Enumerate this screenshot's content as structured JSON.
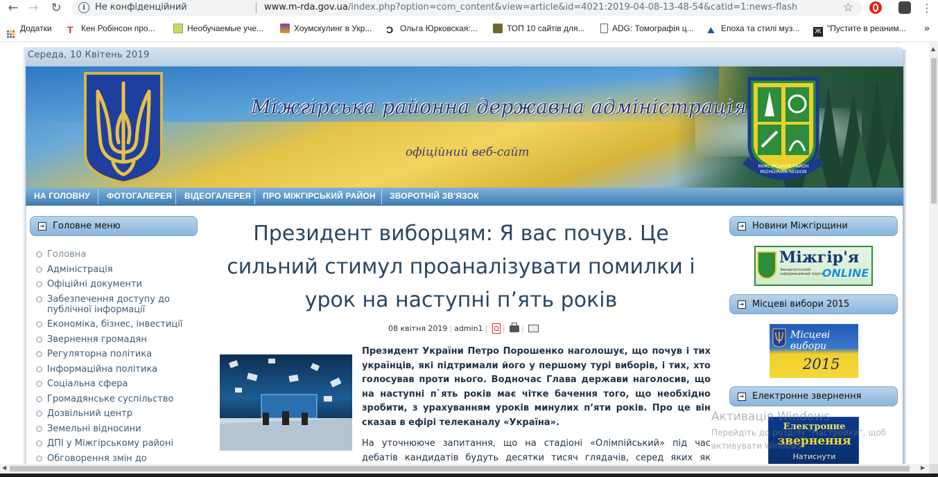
{
  "browser": {
    "security_label": "Не конфіденційний",
    "url_host": "www.m-rda.gov.ua",
    "url_path": "/index.php?option=com_content&view=article&id=4021:2019-04-08-13-48-54&catid=1:news-flash",
    "bookmarks": [
      {
        "label": "Додатки"
      },
      {
        "label": "Кен Робінсон про..."
      },
      {
        "label": "Необучаемые уче..."
      },
      {
        "label": "Хоумскулинг в Укр..."
      },
      {
        "label": "Ольга Юрковская:..."
      },
      {
        "label": "ТОП 10 сайтів для..."
      },
      {
        "label": "ADG: Томографія ц..."
      },
      {
        "label": "Епоха та стилі муз..."
      },
      {
        "label": "\"Пустите в реаним..."
      }
    ],
    "more_bookmarks": "»"
  },
  "site": {
    "date": "Середа, 10 Квітень 2019",
    "title": "Міжгірська районна державна адміністрація",
    "subtitle": "офіційний веб-сайт",
    "emblem_text": "МІЖГІРСЬКИЙ РАЙОН MIZHGIRIAN REGION"
  },
  "topnav": [
    "НА ГОЛОВНУ",
    "ФОТОГАЛЕРЕЯ",
    "ВІДЕОГАЛЕРЕЯ",
    "ПРО МІЖГІРСЬКИЙ РАЙОН",
    "ЗВОРОТНІЙ ЗВ'ЯЗОК"
  ],
  "left": {
    "heading": "Головне меню",
    "items": [
      "Головна",
      "Адміністрація",
      "Офіційні документи",
      "Забезпечення доступу до публічної інформації",
      "Економіка, бізнес, інвестиції",
      "Звернення громадян",
      "Регуляторна політика",
      "Інформаційна політика",
      "Соціальна сфера",
      "Громадянське суспільство",
      "Дозвільний центр",
      "Земельні відносини",
      "ДПІ у Міжгірському районі",
      "Обговорення змін до"
    ]
  },
  "article": {
    "title": "Президент виборцям: Я вас почув. Це сильний стимул проаналізувати помилки і урок на наступні п’ять років",
    "date": "08 квітня 2019",
    "author": "admin1",
    "lead": "Президент України Петро Порошенко наголошує, що почув і тих українців, які підтримали його у першому турі виборів, і тих, хто голосував проти нього. Водночас Глава держави наголосив, що на наступні п`ять років має чітке бачення того, що необхідно зробити, з урахуванням уроків минулих п’яти років. Про це він сказав в ефірі телеканалу «Україна».",
    "body": "На уточнююче запитання, що на стадіоні «Олімпійський» під час дебатів кандидатів будуть десятки тисяч глядачів, серед яких як прихильники Петра"
  },
  "right": {
    "news_heading": "Новини Міжгірщини",
    "news_banner_title": "Міжгір'я",
    "news_banner_sub": "Закарпатський інформаційний портал",
    "news_banner_online": "ONLINE",
    "elections_heading": "Місцеві вибори 2015",
    "elections_banner_title": "Місцеві вибори",
    "elections_banner_year": "2015",
    "appeal_heading": "Електронне звернення",
    "appeal_banner_line1": "Електронне",
    "appeal_banner_line2": "звернення",
    "appeal_banner_line3": "Натиснути"
  },
  "windows_watermark": {
    "title": "Активація Windows",
    "text": "Перейдіть до розділу \"Настройки\", щоб активувати Windows."
  },
  "colors": {
    "menu_blue": "#3e7fb5",
    "title_blue": "#2a4762",
    "module_head": "#8ab6db"
  }
}
